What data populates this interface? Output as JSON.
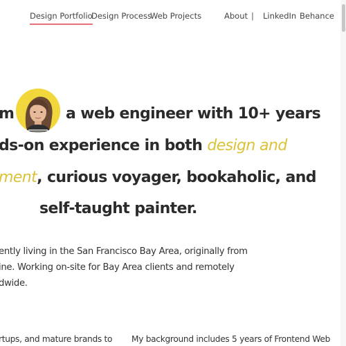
{
  "nav": {
    "left": [
      {
        "label": "Design Portfolio",
        "active": true
      },
      {
        "label": "Design Process",
        "active": false
      },
      {
        "label": "Web Projects",
        "active": false
      }
    ],
    "right": [
      {
        "label": "About"
      },
      {
        "label": "LinkedIn"
      },
      {
        "label": "Behance"
      }
    ],
    "separator": "|"
  },
  "hero": {
    "line1_before": "m",
    "line1_after": "a web engineer with 10+ years",
    "line2_text": "ds-on experience in both ",
    "line2_accent": "design and",
    "line3_accent": "ment",
    "line3_text": ", curious voyager, bookaholic, and",
    "line4_text": "self-taught painter."
  },
  "about": {
    "line1": "ently living in the San Francisco Bay Area, originally from",
    "line2": "ine. Working on-site for Bay Area clients and remotely",
    "line3": "dwide."
  },
  "columns": {
    "left_text": "rtups, and mature brands to",
    "right_text": "My background includes 5 years of Frontend Web"
  },
  "colors": {
    "accent_yellow": "#dcc238",
    "active_underline": "#e9707a",
    "avatar_bg": "#f2d73c",
    "text": "#2b2b2b"
  },
  "icons": {
    "avatar": "profile-photo"
  }
}
